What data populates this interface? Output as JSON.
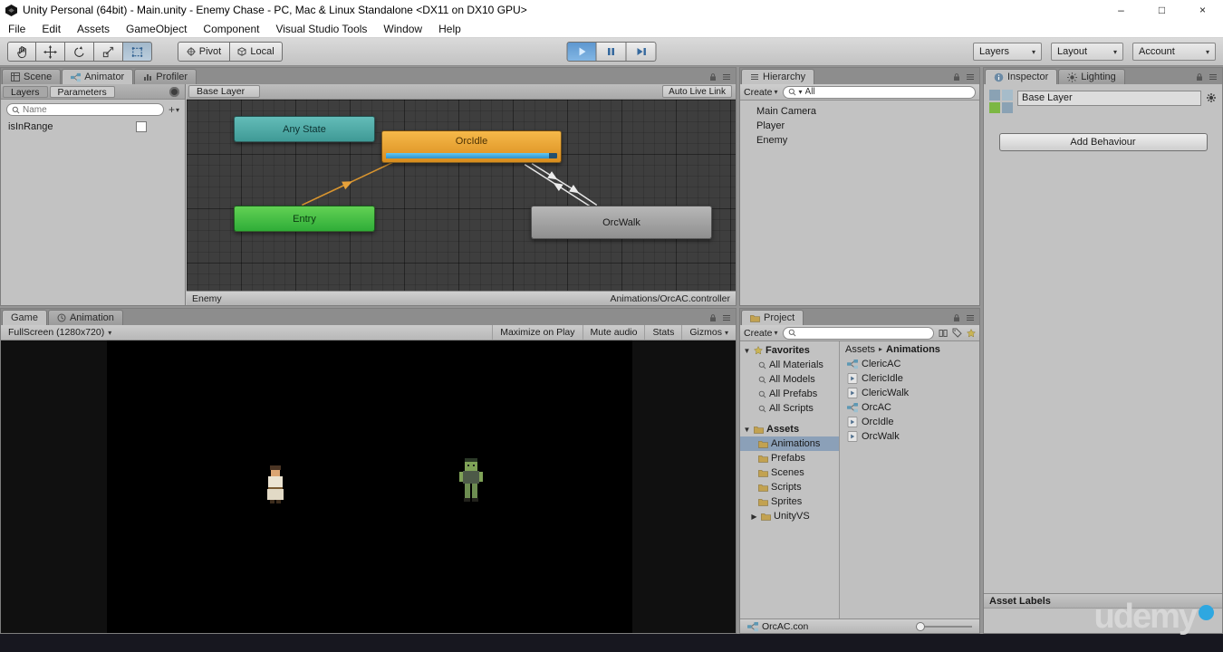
{
  "window": {
    "title": "Unity Personal (64bit) - Main.unity - Enemy Chase - PC, Mac & Linux Standalone <DX11 on DX10 GPU>",
    "controls": {
      "minimize": "–",
      "maximize": "□",
      "close": "×"
    }
  },
  "menubar": {
    "items": [
      "File",
      "Edit",
      "Assets",
      "GameObject",
      "Component",
      "Visual Studio Tools",
      "Window",
      "Help"
    ]
  },
  "toolbar": {
    "pivot": "Pivot",
    "local": "Local",
    "layers": "Layers",
    "layout": "Layout",
    "account": "Account"
  },
  "animator": {
    "dock_tabs": [
      "Scene",
      "Animator",
      "Profiler"
    ],
    "sidebar": {
      "tabs": [
        "Layers",
        "Parameters"
      ],
      "search_placeholder": "Name",
      "parameter": "isInRange",
      "parameter_checked": false
    },
    "breadcrumb": "Base Layer",
    "auto_live_link": "Auto Live Link",
    "nodes": {
      "any_state": "Any State",
      "orc_idle": "OrcIdle",
      "entry": "Entry",
      "orc_walk": "OrcWalk"
    },
    "orc_idle_progress": 0.95,
    "colors": {
      "any_state": "#4aa6a6",
      "orc_idle": "#eda938",
      "entry": "#46c24d",
      "orc_walk": "#9d9d9d",
      "progress_fill": "#41ace3",
      "transition_entry": "#d9952f",
      "transition_default": "#e8e8e8"
    },
    "status": {
      "left": "Enemy",
      "right": "Animations/OrcAC.controller"
    }
  },
  "game": {
    "dock_tabs": [
      "Game",
      "Animation"
    ],
    "aspect": "FullScreen (1280x720)",
    "buttons": [
      "Maximize on Play",
      "Mute audio",
      "Stats",
      "Gizmos"
    ]
  },
  "hierarchy": {
    "tab": "Hierarchy",
    "create": "Create",
    "search_text": "All",
    "items": [
      "Main Camera",
      "Player",
      "Enemy"
    ]
  },
  "project": {
    "tab": "Project",
    "create": "Create",
    "favorites": {
      "label": "Favorites",
      "items": [
        "All Materials",
        "All Models",
        "All Prefabs",
        "All Scripts"
      ]
    },
    "assets": {
      "label": "Assets",
      "folders": [
        "Animations",
        "Prefabs",
        "Scenes",
        "Scripts",
        "Sprites",
        "UnityVS"
      ],
      "selected": "Animations"
    },
    "breadcrumb": {
      "root": "Assets",
      "current": "Animations"
    },
    "files": [
      {
        "name": "ClericAC",
        "kind": "animator-controller"
      },
      {
        "name": "ClericIdle",
        "kind": "animation-clip"
      },
      {
        "name": "ClericWalk",
        "kind": "animation-clip"
      },
      {
        "name": "OrcAC",
        "kind": "animator-controller"
      },
      {
        "name": "OrcIdle",
        "kind": "animation-clip"
      },
      {
        "name": "OrcWalk",
        "kind": "animation-clip"
      }
    ],
    "footer": {
      "selected": "OrcAC.con"
    }
  },
  "inspector": {
    "tabs": [
      "Inspector",
      "Lighting"
    ],
    "layer_name": "Base Layer",
    "add_behaviour": "Add Behaviour",
    "asset_labels": "Asset Labels"
  },
  "watermark": "udemy"
}
